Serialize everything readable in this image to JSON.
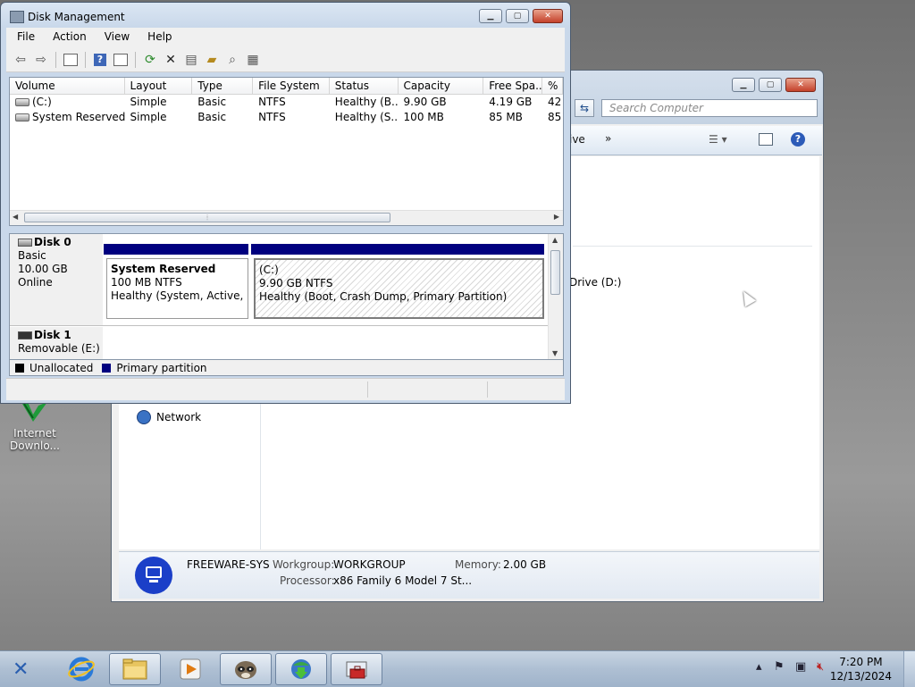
{
  "desktop": {
    "icons": [
      {
        "label_line1": "Internet",
        "label_line2": "Downlo..."
      }
    ]
  },
  "explorer": {
    "search_placeholder": "Search Computer",
    "cmd_text": "ive",
    "cmd_more": "»",
    "drive_d": "Drive (D:)",
    "network": "Network",
    "details": {
      "computer_name": "FREEWARE-SYS",
      "workgroup_label": "Workgroup:",
      "workgroup_value": "WORKGROUP",
      "memory_label": "Memory:",
      "memory_value": "2.00 GB",
      "processor_label": "Processor:",
      "processor_value": "x86 Family 6 Model 7 St..."
    }
  },
  "disk_management": {
    "title": "Disk Management",
    "menu": [
      "File",
      "Action",
      "View",
      "Help"
    ],
    "columns": [
      "Volume",
      "Layout",
      "Type",
      "File System",
      "Status",
      "Capacity",
      "Free Spa...",
      "% F"
    ],
    "volumes": [
      [
        "(C:)",
        "Simple",
        "Basic",
        "NTFS",
        "Healthy (B...",
        "9.90 GB",
        "4.19 GB",
        "42"
      ],
      [
        "System Reserved",
        "Simple",
        "Basic",
        "NTFS",
        "Healthy (S...",
        "100 MB",
        "85 MB",
        "85"
      ]
    ],
    "disks": [
      {
        "name": "Disk 0",
        "type": "Basic",
        "size": "10.00 GB",
        "state": "Online",
        "partitions": [
          {
            "name": "System Reserved",
            "size": "100 MB NTFS",
            "status": "Healthy (System, Active, Prir"
          },
          {
            "name": "(C:)",
            "size": "9.90 GB NTFS",
            "status": "Healthy (Boot, Crash Dump, Primary Partition)"
          }
        ]
      },
      {
        "name": "Disk 1",
        "type": "Removable (E:)"
      }
    ],
    "legend": [
      {
        "label": "Unallocated",
        "color": "#000000"
      },
      {
        "label": "Primary partition",
        "color": "#00007f"
      }
    ]
  },
  "taskbar": {
    "clock_time": "7:20 PM",
    "clock_date": "12/13/2024"
  }
}
